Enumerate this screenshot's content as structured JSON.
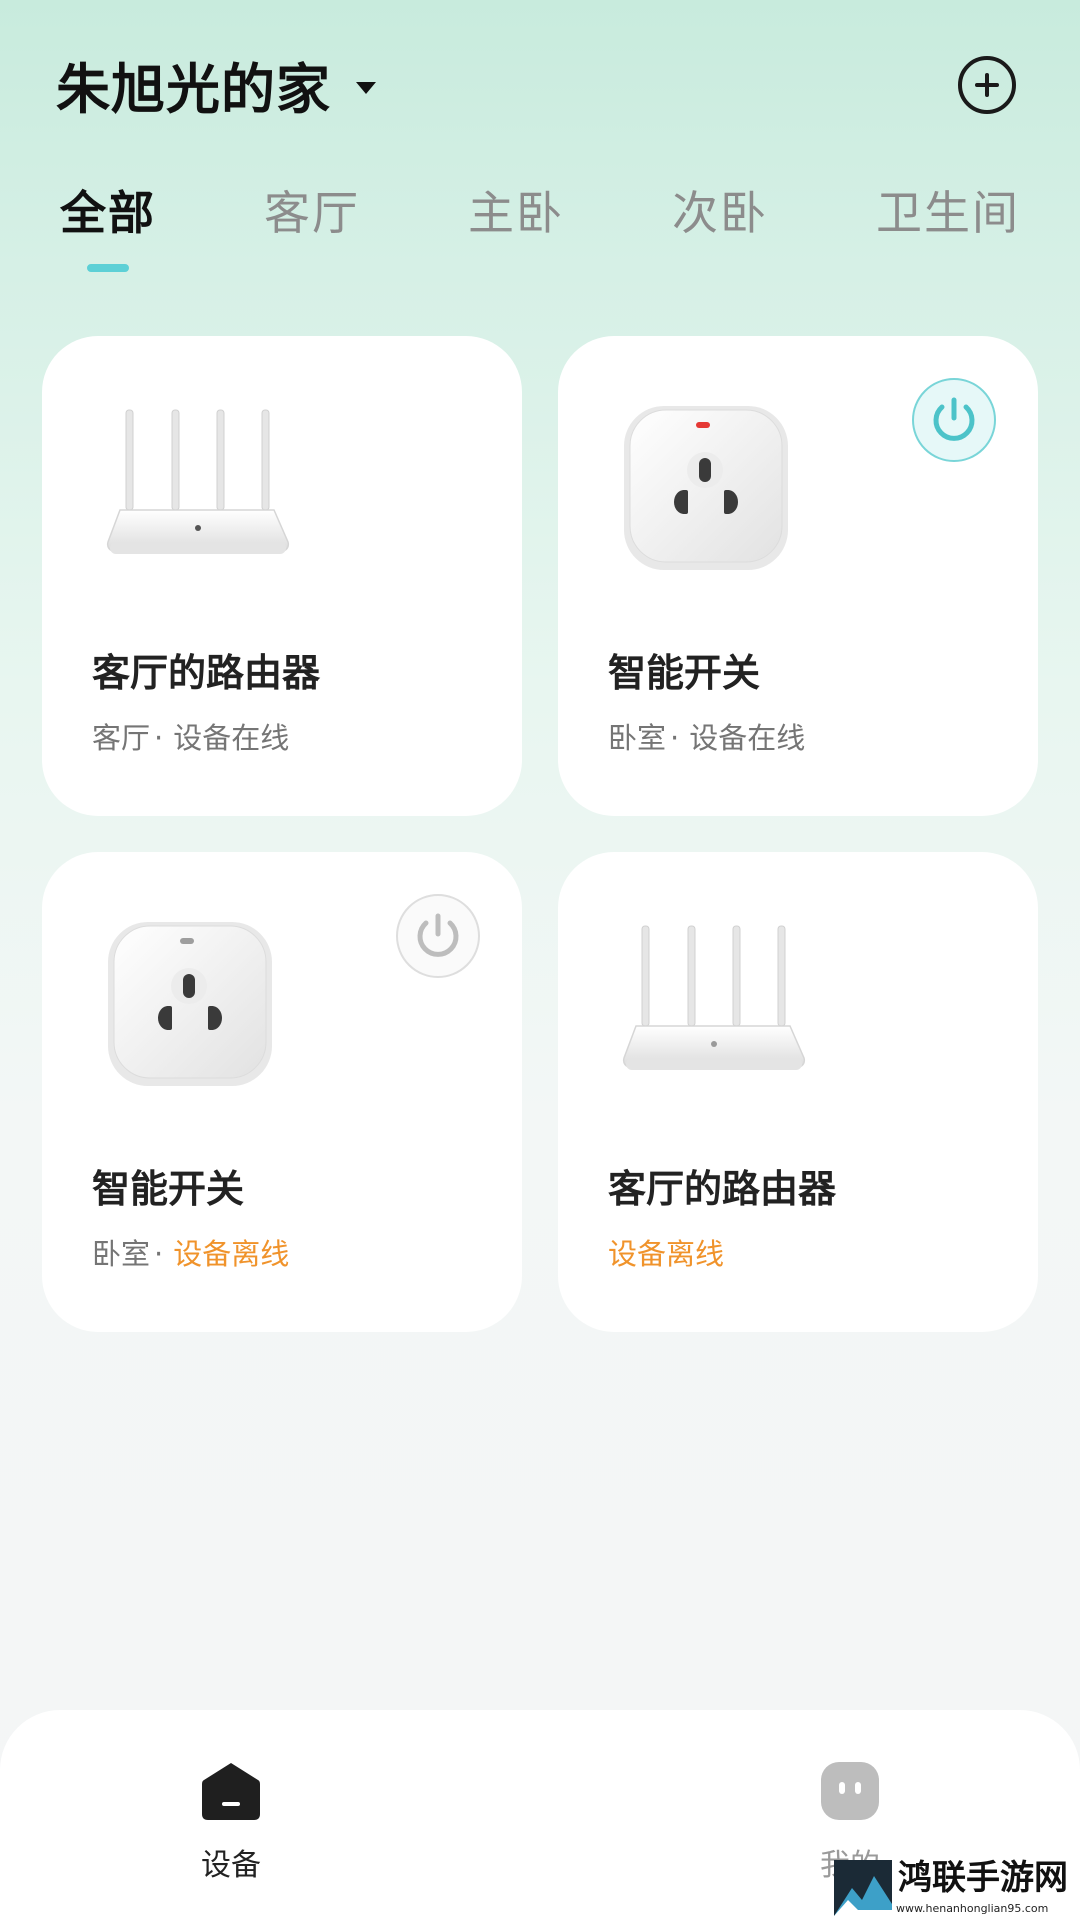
{
  "header": {
    "home_name": "朱旭光的家",
    "add_icon": "plus-circle-icon",
    "dropdown_icon": "caret-down-icon"
  },
  "tabs": [
    {
      "label": "全部",
      "active": true
    },
    {
      "label": "客厅",
      "active": false
    },
    {
      "label": "主卧",
      "active": false
    },
    {
      "label": "次卧",
      "active": false
    },
    {
      "label": "卫生间",
      "active": false
    }
  ],
  "devices": [
    {
      "name": "客厅的路由器",
      "room": "客厅",
      "separator": "·",
      "status": "设备在线",
      "online": true,
      "type": "router",
      "icon": "router-icon"
    },
    {
      "name": "智能开关",
      "room": "卧室",
      "separator": "·",
      "status": "设备在线",
      "online": true,
      "type": "plug",
      "icon": "smart-plug-icon",
      "power": "on"
    },
    {
      "name": "智能开关",
      "room": "卧室",
      "separator": "·",
      "status": "设备离线",
      "online": false,
      "type": "plug",
      "icon": "smart-plug-icon",
      "power": "off"
    },
    {
      "name": "客厅的路由器",
      "room": "",
      "separator": "",
      "status": "设备离线",
      "online": false,
      "type": "router",
      "icon": "router-icon"
    }
  ],
  "bottom_nav": [
    {
      "label": "设备",
      "icon": "home-icon",
      "active": true
    },
    {
      "label": "我的",
      "icon": "profile-face-icon",
      "active": false
    }
  ],
  "watermark": {
    "title": "鸿联手游网",
    "url": "www.henanhonglian95.com"
  },
  "colors": {
    "accent": "#5dd0d6",
    "offline": "#f0932b",
    "card_bg": "#ffffff",
    "text_primary": "#222222",
    "text_secondary": "#757575"
  }
}
